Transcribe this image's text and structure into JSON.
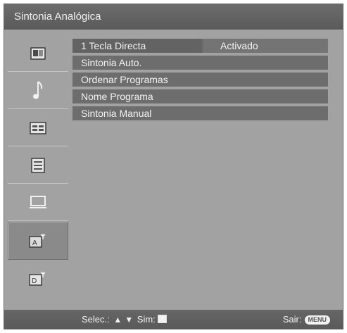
{
  "title": "Sintonia Analógica",
  "sidebar": {
    "items": [
      {
        "icon": "picture-settings-icon",
        "selected": false
      },
      {
        "icon": "sound-music-note-icon",
        "selected": false
      },
      {
        "icon": "screen-settings-icon",
        "selected": false
      },
      {
        "icon": "setup-list-icon",
        "selected": false
      },
      {
        "icon": "pc-monitor-icon",
        "selected": false
      },
      {
        "icon": "analog-tuning-antenna-icon",
        "selected": true
      },
      {
        "icon": "digital-tuning-antenna-icon",
        "selected": false
      }
    ]
  },
  "menu": {
    "items": [
      {
        "label": "1 Tecla Directa",
        "value": "Activado"
      },
      {
        "label": "Sintonia Auto."
      },
      {
        "label": "Ordenar Programas"
      },
      {
        "label": "Nome Programa"
      },
      {
        "label": "Sintonia Manual"
      }
    ]
  },
  "footer": {
    "select_label": "Selec.:",
    "confirm_label": "Sim:",
    "exit_label": "Sair:",
    "menu_key": "MENU"
  }
}
